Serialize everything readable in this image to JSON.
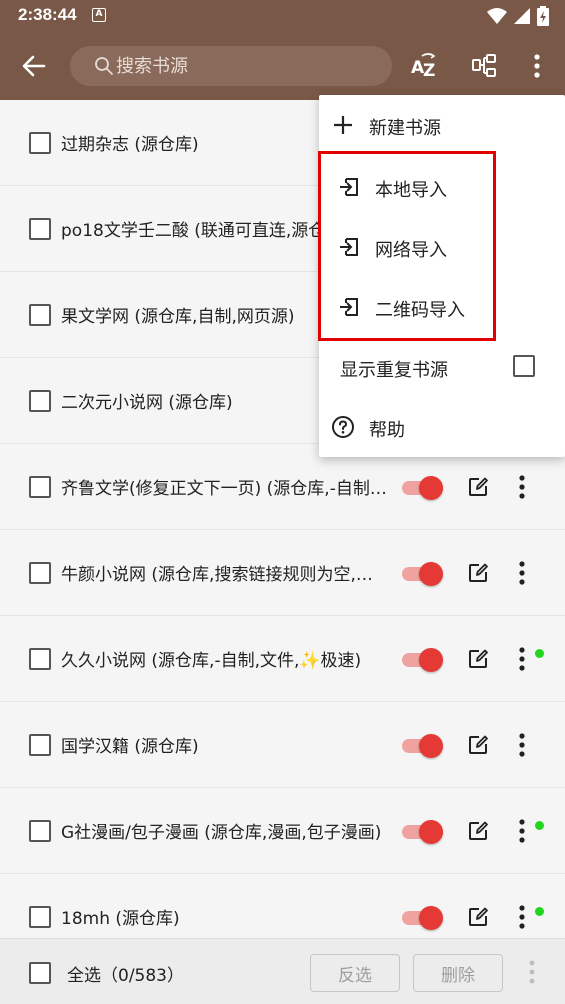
{
  "status_bar": {
    "time": "2:38:44",
    "notif_letter": "A"
  },
  "toolbar": {
    "search_placeholder": "搜索书源",
    "sort_icon": "sort-az-icon",
    "group_icon": "group-icon",
    "more_icon": "more-vert-icon"
  },
  "sources": [
    {
      "name": "过期杂志 (源仓库)",
      "enabled": true,
      "new": false
    },
    {
      "name": "po18文学壬二酸 (联通可直连,源仓库)",
      "enabled": true,
      "new": false
    },
    {
      "name": "果文学网 (源仓库,自制,网页源)",
      "enabled": true,
      "new": false
    },
    {
      "name": "二次元小说网 (源仓库)",
      "enabled": true,
      "new": false
    },
    {
      "name": "齐鲁文学(修复正文下一页) (源仓库,-自制…",
      "enabled": true,
      "new": false
    },
    {
      "name": "牛颜小说网 (源仓库,搜索链接规则为空,…",
      "enabled": true,
      "new": false
    },
    {
      "name": "久久小说网 (源仓库,-自制,文件,✨极速)",
      "enabled": true,
      "new": true
    },
    {
      "name": "国学汉籍 (源仓库)",
      "enabled": true,
      "new": false
    },
    {
      "name": "G社漫画/包子漫画 (源仓库,漫画,包子漫画)",
      "enabled": true,
      "new": true
    },
    {
      "name": "18mh (源仓库)",
      "enabled": true,
      "new": true
    }
  ],
  "menu": {
    "new_source": "新建书源",
    "local_import": "本地导入",
    "network_import": "网络导入",
    "qr_import": "二维码导入",
    "show_duplicates": "显示重复书源",
    "help": "帮助"
  },
  "bottom_bar": {
    "select_all": "全选（0/583）",
    "invert": "反选",
    "delete": "删除"
  },
  "colors": {
    "toolbar": "#795848",
    "accent": "#e53935",
    "new_dot": "#22d61e",
    "highlight": "#e00000"
  }
}
